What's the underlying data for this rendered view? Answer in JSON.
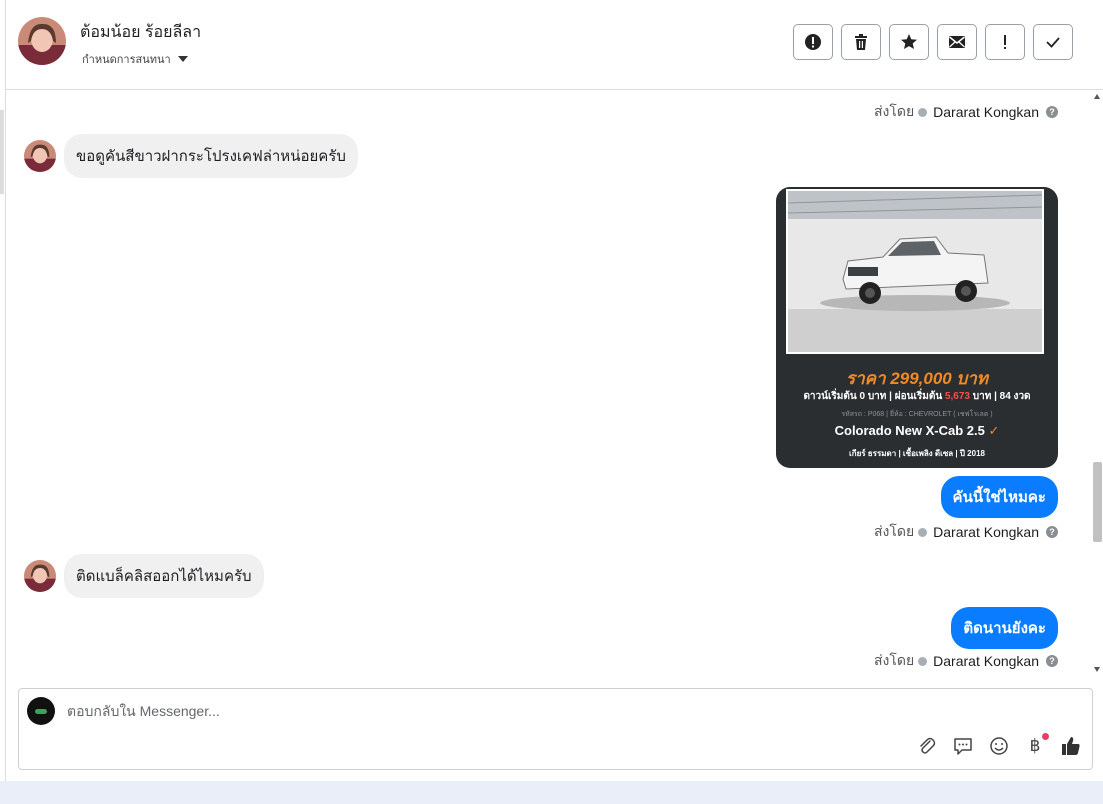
{
  "header": {
    "contact_name": "ต้อมน้อย ร้อยลีลา",
    "assign_label": "กำหนดการสนทนา",
    "actions": [
      {
        "name": "mark-spam-button",
        "icon": "alert-circle-icon"
      },
      {
        "name": "delete-button",
        "icon": "trash-icon"
      },
      {
        "name": "star-button",
        "icon": "star-icon"
      },
      {
        "name": "mark-unread-button",
        "icon": "envelope-icon"
      },
      {
        "name": "follow-up-button",
        "icon": "exclamation-icon"
      },
      {
        "name": "mark-done-button",
        "icon": "check-icon"
      }
    ]
  },
  "messages": {
    "sent_by_prefix": "ส่งโดย",
    "agent_name": "Dararat Kongkan",
    "help_icon_glyph": "?",
    "incoming_1": "ขอดูคันสีขาวฝากระโปรงเคฟล่าหน่อยครับ",
    "incoming_2": "ติดแบล็คลิสออกได้ไหมครับ",
    "outgoing_1": "คันนี้ใช่ไหมคะ",
    "outgoing_2": "ติดนานยังคะ",
    "car_card": {
      "price": "ราคา 299,000 บาท",
      "down_prefix": "ดาวน์เริ่มต้น 0 บาท | ผ่อนเริ่มต้น",
      "installment": "5,673",
      "down_suffix": "บาท | 84 งวด",
      "code_line": "รหัสรถ : P068 | ยี่ห้อ : CHEVROLET ( เชฟโรเลต )",
      "model": "Colorado New X-Cab 2.5",
      "specs": "เกียร์ ธรรมดา   |   เชื้อเพลิง ดีเซล   |   ปี 2018"
    }
  },
  "composer": {
    "placeholder": "ตอบกลับใน Messenger...",
    "baht_glyph": "฿"
  },
  "colors": {
    "accent": "#0a7cff",
    "price_orange": "#f08a24",
    "installment_red": "#ff4b4b",
    "incoming_bubble": "#f0f0f0"
  }
}
